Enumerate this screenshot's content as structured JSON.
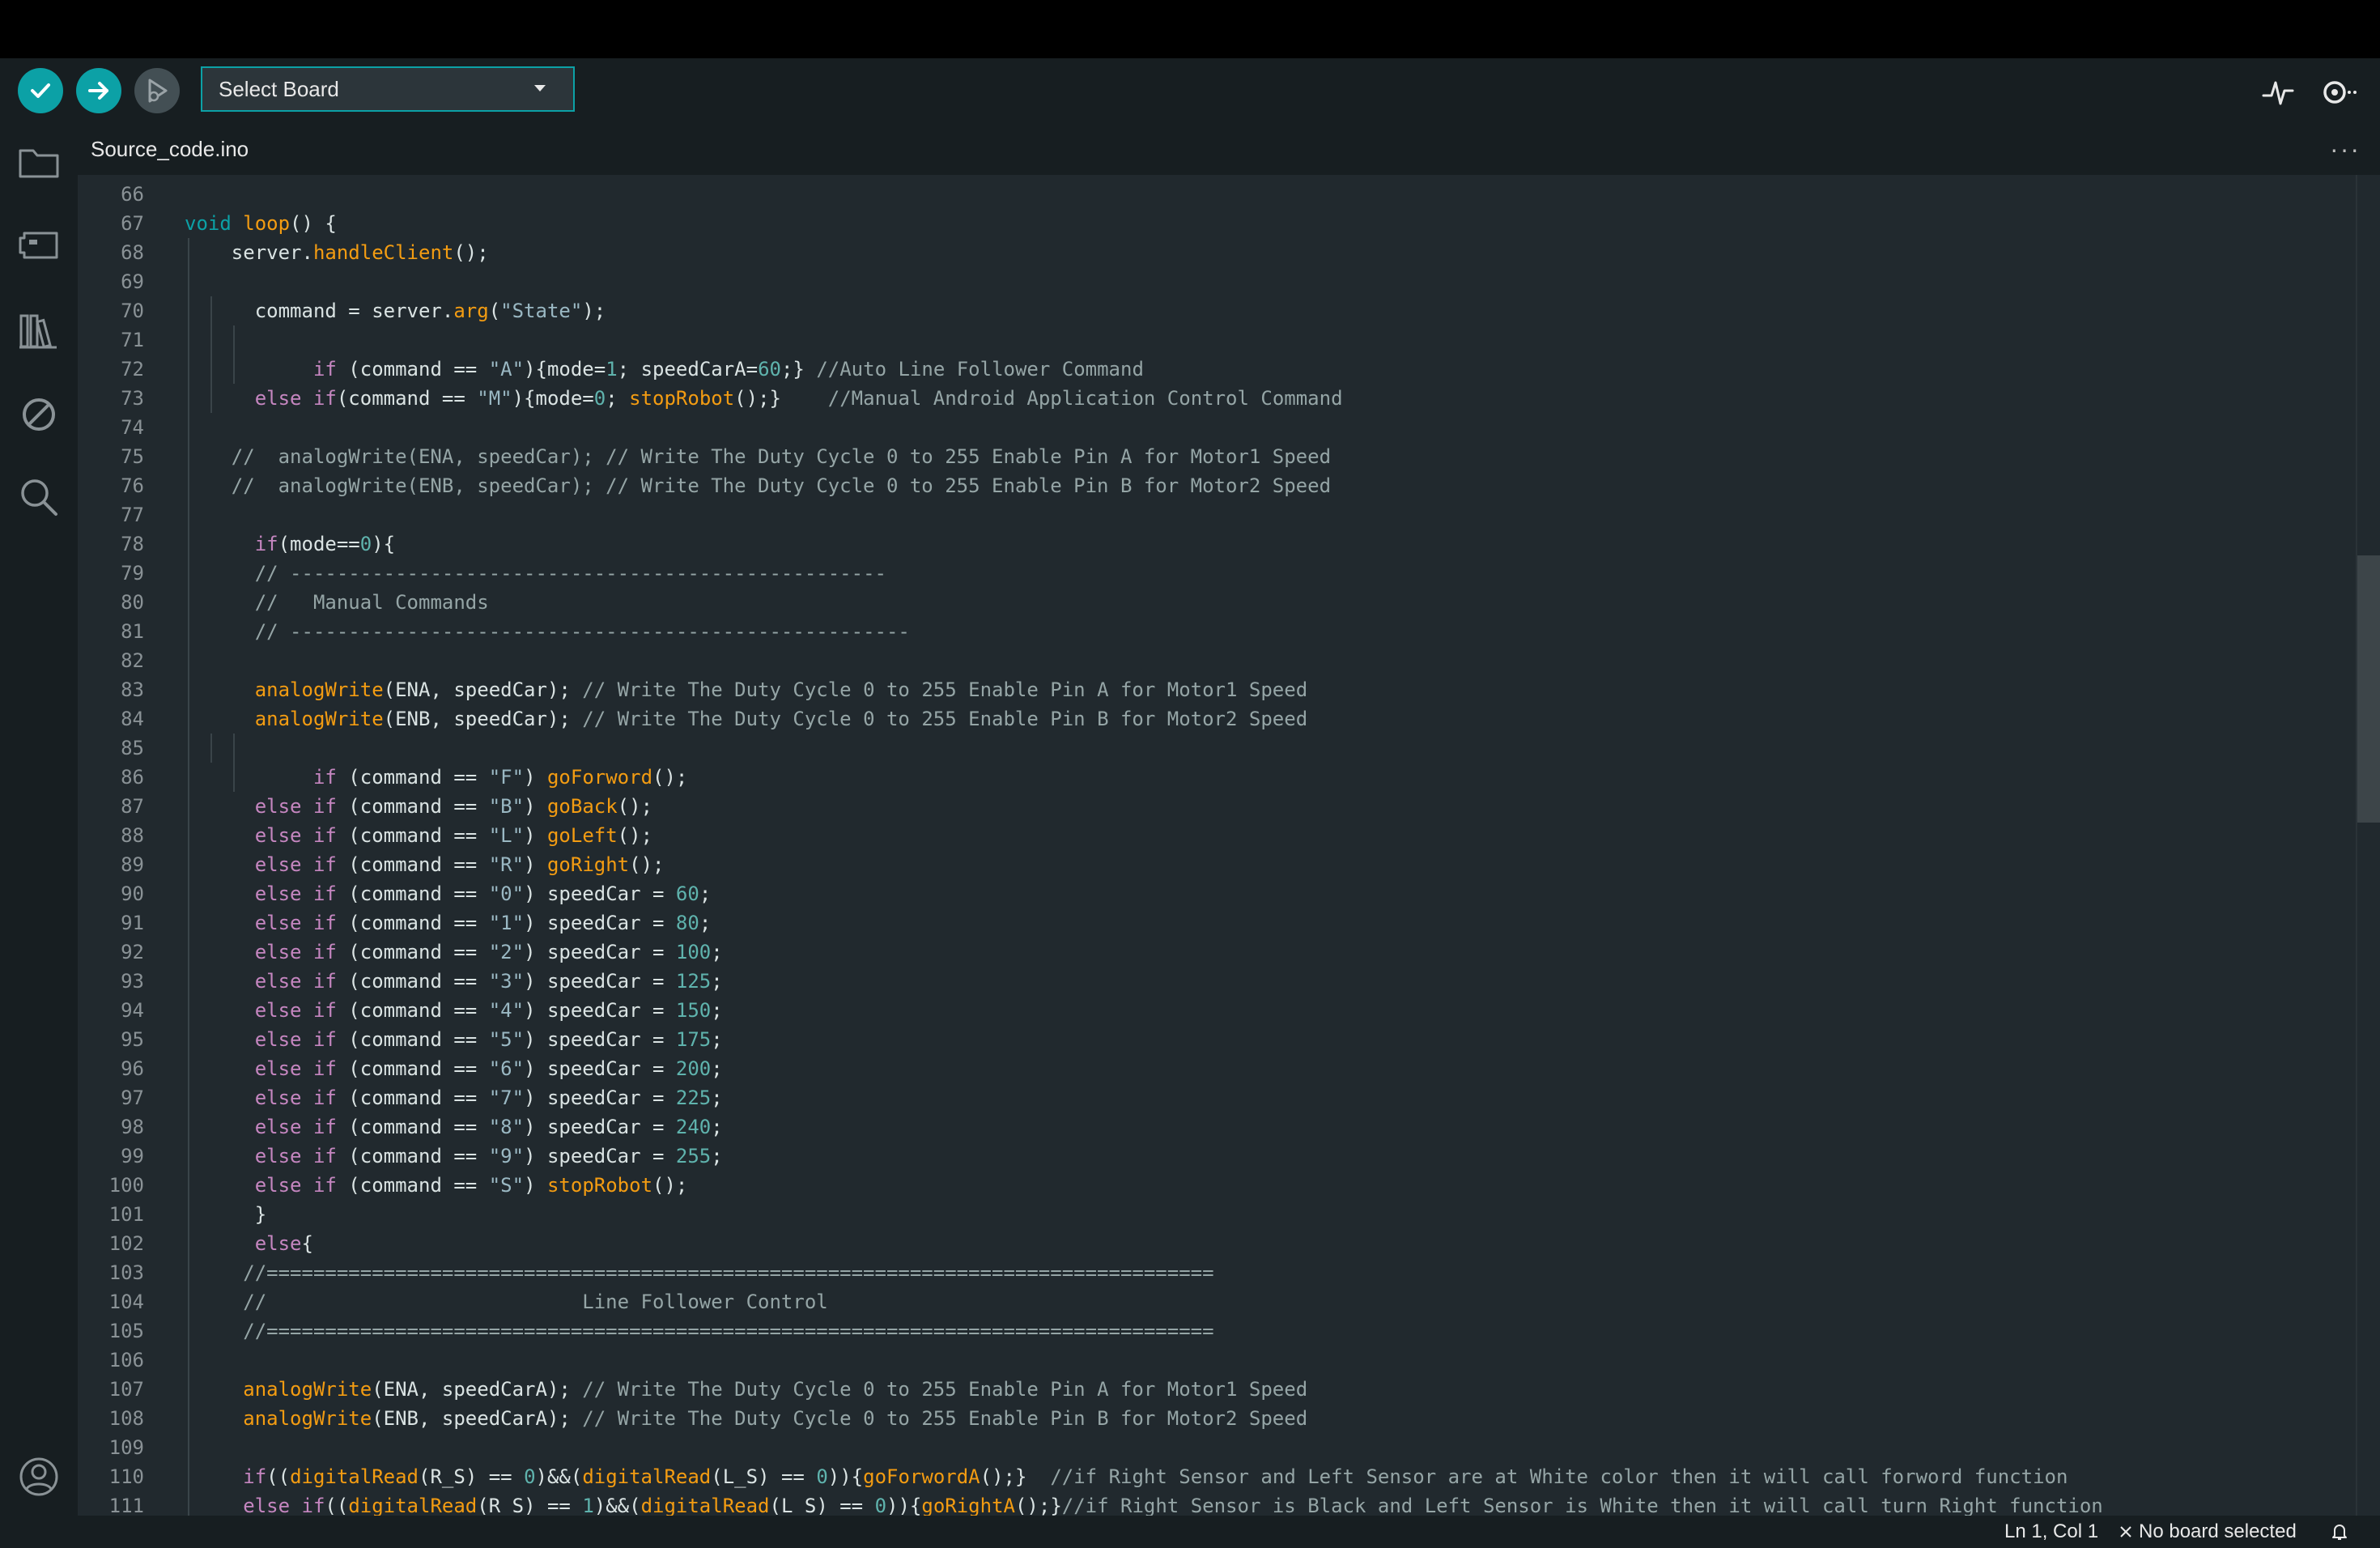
{
  "toolbar": {
    "verify_icon": "check-icon",
    "upload_icon": "arrow-right-icon",
    "debug_icon": "debug-icon",
    "board_select_label": "Select Board",
    "serial_plotter_icon": "serial-plotter-icon",
    "serial_monitor_icon": "serial-monitor-icon"
  },
  "sidebar": {
    "items": [
      {
        "icon": "folder-icon"
      },
      {
        "icon": "board-icon"
      },
      {
        "icon": "library-icon"
      },
      {
        "icon": "debug-off-icon"
      },
      {
        "icon": "search-icon"
      }
    ],
    "account_icon": "account-icon"
  },
  "tab": {
    "active_label": "Source_code.ino",
    "more_label": "···"
  },
  "editor": {
    "lines": [
      {
        "n": "66",
        "code": ""
      },
      {
        "n": "67",
        "code": "void loop() {"
      },
      {
        "n": "68",
        "code": "    server.handleClient();"
      },
      {
        "n": "69",
        "code": ""
      },
      {
        "n": "70",
        "code": "      command = server.arg(\"State\");"
      },
      {
        "n": "71",
        "code": ""
      },
      {
        "n": "72",
        "code": "           if (command == \"A\"){mode=1; speedCarA=60;} //Auto Line Follower Command"
      },
      {
        "n": "73",
        "code": "      else if(command == \"M\"){mode=0; stopRobot();}    //Manual Android Application Control Command"
      },
      {
        "n": "74",
        "code": ""
      },
      {
        "n": "75",
        "code": "    //  analogWrite(ENA, speedCar); // Write The Duty Cycle 0 to 255 Enable Pin A for Motor1 Speed"
      },
      {
        "n": "76",
        "code": "    //  analogWrite(ENB, speedCar); // Write The Duty Cycle 0 to 255 Enable Pin B for Motor2 Speed"
      },
      {
        "n": "77",
        "code": ""
      },
      {
        "n": "78",
        "code": "      if(mode==0){"
      },
      {
        "n": "79",
        "code": "      // ---------------------------------------------------"
      },
      {
        "n": "80",
        "code": "      //   Manual Commands"
      },
      {
        "n": "81",
        "code": "      // -----------------------------------------------------"
      },
      {
        "n": "82",
        "code": ""
      },
      {
        "n": "83",
        "code": "      analogWrite(ENA, speedCar); // Write The Duty Cycle 0 to 255 Enable Pin A for Motor1 Speed"
      },
      {
        "n": "84",
        "code": "      analogWrite(ENB, speedCar); // Write The Duty Cycle 0 to 255 Enable Pin B for Motor2 Speed"
      },
      {
        "n": "85",
        "code": ""
      },
      {
        "n": "86",
        "code": "           if (command == \"F\") goForword();"
      },
      {
        "n": "87",
        "code": "      else if (command == \"B\") goBack();"
      },
      {
        "n": "88",
        "code": "      else if (command == \"L\") goLeft();"
      },
      {
        "n": "89",
        "code": "      else if (command == \"R\") goRight();"
      },
      {
        "n": "90",
        "code": "      else if (command == \"0\") speedCar = 60;"
      },
      {
        "n": "91",
        "code": "      else if (command == \"1\") speedCar = 80;"
      },
      {
        "n": "92",
        "code": "      else if (command == \"2\") speedCar = 100;"
      },
      {
        "n": "93",
        "code": "      else if (command == \"3\") speedCar = 125;"
      },
      {
        "n": "94",
        "code": "      else if (command == \"4\") speedCar = 150;"
      },
      {
        "n": "95",
        "code": "      else if (command == \"5\") speedCar = 175;"
      },
      {
        "n": "96",
        "code": "      else if (command == \"6\") speedCar = 200;"
      },
      {
        "n": "97",
        "code": "      else if (command == \"7\") speedCar = 225;"
      },
      {
        "n": "98",
        "code": "      else if (command == \"8\") speedCar = 240;"
      },
      {
        "n": "99",
        "code": "      else if (command == \"9\") speedCar = 255;"
      },
      {
        "n": "100",
        "code": "      else if (command == \"S\") stopRobot();"
      },
      {
        "n": "101",
        "code": "      }"
      },
      {
        "n": "102",
        "code": "      else{"
      },
      {
        "n": "103",
        "code": "     //================================================================================="
      },
      {
        "n": "104",
        "code": "     //                           Line Follower Control"
      },
      {
        "n": "105",
        "code": "     //================================================================================="
      },
      {
        "n": "106",
        "code": ""
      },
      {
        "n": "107",
        "code": "     analogWrite(ENA, speedCarA); // Write The Duty Cycle 0 to 255 Enable Pin A for Motor1 Speed"
      },
      {
        "n": "108",
        "code": "     analogWrite(ENB, speedCarA); // Write The Duty Cycle 0 to 255 Enable Pin B for Motor2 Speed"
      },
      {
        "n": "109",
        "code": ""
      },
      {
        "n": "110",
        "code": "     if((digitalRead(R_S) == 0)&&(digitalRead(L_S) == 0)){goForwordA();}  //if Right Sensor and Left Sensor are at White color then it will call forword function"
      },
      {
        "n": "111",
        "code": "     else if((digitalRead(R_S) == 1)&&(digitalRead(L_S) == 0)){goRightA();}//if Right Sensor is Black and Left Sensor is White then it will call turn Right function"
      }
    ]
  },
  "statusbar": {
    "position": "Ln 1, Col 1",
    "board_status": "No board selected",
    "close_icon": "close-icon",
    "bell_icon": "bell-icon"
  },
  "colors": {
    "accent": "#0ca1a6",
    "editor_bg": "#21292e",
    "chrome_bg": "#171e21"
  }
}
